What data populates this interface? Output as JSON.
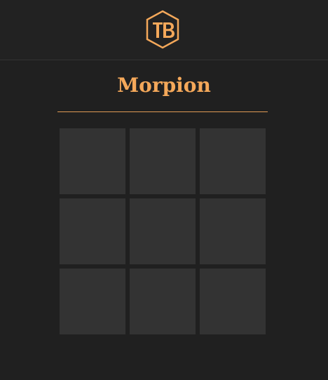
{
  "header": {
    "logo_text": "TB",
    "logo_color": "#f4a85a"
  },
  "game": {
    "title": "Morpion",
    "accent_color": "#f4a85a",
    "board": [
      [
        "",
        "",
        ""
      ],
      [
        "",
        "",
        ""
      ],
      [
        "",
        "",
        ""
      ]
    ]
  }
}
